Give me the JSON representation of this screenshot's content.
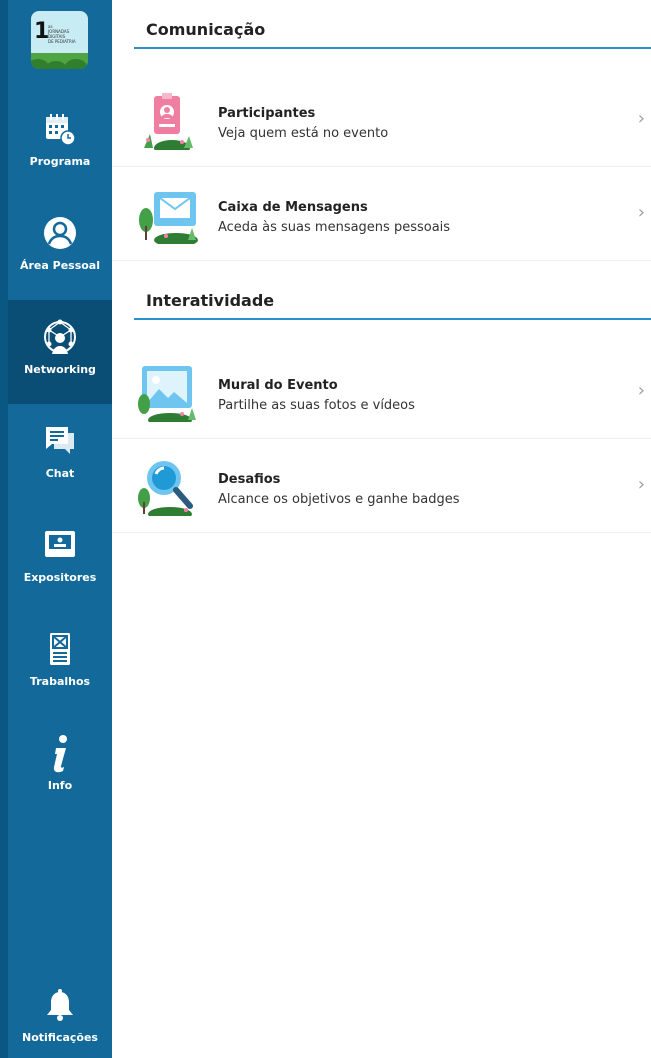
{
  "sidebar": {
    "logo": {
      "number": "1",
      "superscript": "as",
      "lines": [
        "JORNADAS",
        "DIGITAIS",
        "DE PEDIATRIA"
      ]
    },
    "items": [
      {
        "label": "Programa",
        "icon": "calendar-clock-icon"
      },
      {
        "label": "Área Pessoal",
        "icon": "user-circle-icon"
      },
      {
        "label": "Networking",
        "icon": "network-globe-icon",
        "active": true
      },
      {
        "label": "Chat",
        "icon": "chat-bubble-icon"
      },
      {
        "label": "Expositores",
        "icon": "exhibitor-screen-icon"
      },
      {
        "label": "Trabalhos",
        "icon": "document-icon"
      },
      {
        "label": "Info",
        "icon": "info-icon"
      },
      {
        "label": "Notificações",
        "icon": "bell-icon"
      }
    ]
  },
  "sections": [
    {
      "title": "Comunicação",
      "rows": [
        {
          "title": "Participantes",
          "subtitle": "Veja quem está no evento",
          "icon": "badge-illustration"
        },
        {
          "title": "Caixa de Mensagens",
          "subtitle": "Aceda às suas mensagens pessoais",
          "icon": "envelope-illustration"
        }
      ]
    },
    {
      "title": "Interatividade",
      "rows": [
        {
          "title": "Mural do Evento",
          "subtitle": "Partilhe as suas fotos e vídeos",
          "icon": "picture-illustration"
        },
        {
          "title": "Desafios",
          "subtitle": "Alcance os objetivos e ganhe badges",
          "icon": "magnifier-illustration"
        }
      ]
    }
  ],
  "colors": {
    "sidebar": "#136a9a",
    "sidebar_active": "#0a4d75",
    "accent_line": "#2a90d0",
    "chevron": "#9aa0a6"
  }
}
